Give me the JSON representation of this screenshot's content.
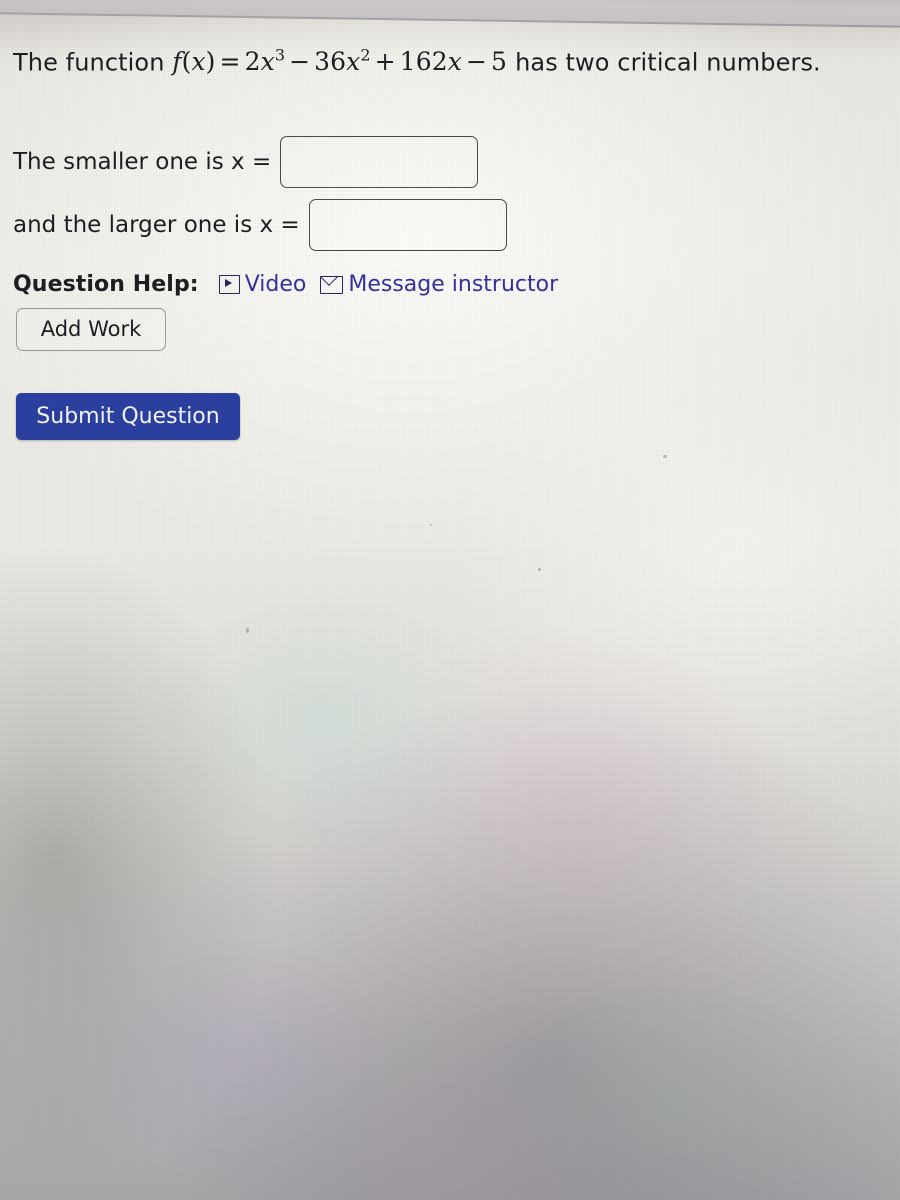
{
  "page": {
    "background_color": "#eeece6",
    "text_color": "#1d1d22"
  },
  "question": {
    "prefix": "The function",
    "math": {
      "fname": "f",
      "open_paren": "(",
      "variable": "x",
      "close_paren": ")",
      "equals": "=",
      "term1_coeff": "2",
      "term1_var": "x",
      "term1_exp": "3",
      "minus1": "−",
      "term2_coeff": "36",
      "term2_var": "x",
      "term2_exp": "2",
      "plus1": "+",
      "term3_coeff": "162",
      "term3_var": "x",
      "minus2": "−",
      "term4_const": "5",
      "plain": "f(x) = 2x^3 - 36x^2 + 162x - 5"
    },
    "suffix": "has two critical numbers."
  },
  "answers": {
    "smaller": {
      "label": "The smaller one is x =",
      "value": "",
      "placeholder": ""
    },
    "larger": {
      "label": "and the larger one is x =",
      "value": "",
      "placeholder": ""
    }
  },
  "help": {
    "label": "Question Help:",
    "link_color": "#35309a",
    "links": [
      {
        "label": "Video",
        "icon": "play-box-icon"
      },
      {
        "label": "Message instructor",
        "icon": "envelope-icon"
      }
    ]
  },
  "buttons": {
    "add_work": {
      "label": "Add Work",
      "background": "transparent",
      "border_color": "#9a9894"
    },
    "submit": {
      "label": "Submit Question",
      "background": "#2b3f9e",
      "text_color": "#f2f2f6"
    }
  }
}
